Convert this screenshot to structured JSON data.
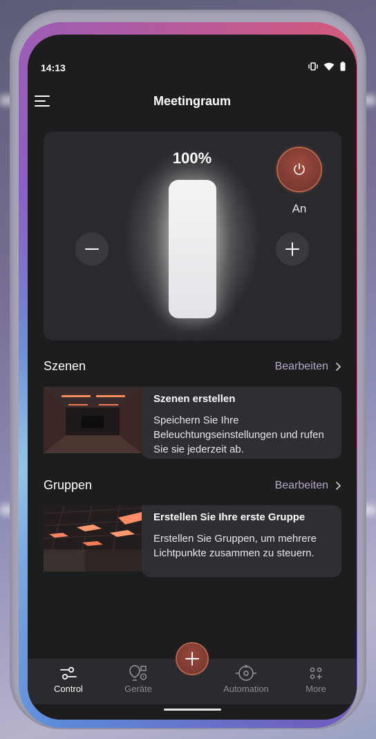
{
  "status": {
    "time": "14:13"
  },
  "header": {
    "title": "Meetingraum"
  },
  "control": {
    "brightness_text": "100%",
    "brightness_level": 1.0,
    "power_label": "An"
  },
  "scenes": {
    "title": "Szenen",
    "edit_label": "Bearbeiten",
    "card_title": "Szenen erstellen",
    "card_desc": "Speichern Sie Ihre Beleuchtungseinstellungen und rufen Sie sie jederzeit ab."
  },
  "groups": {
    "title": "Gruppen",
    "edit_label": "Bearbeiten",
    "card_title": "Erstellen Sie Ihre erste Gruppe",
    "card_desc": "Erstellen Sie Gruppen, um mehrere Lichtpunkte zusammen zu steuern."
  },
  "nav": {
    "items": [
      {
        "label": "Control",
        "icon": "control-icon",
        "active": true
      },
      {
        "label": "Geräte",
        "icon": "devices-icon",
        "active": false
      },
      {
        "label": "Automation",
        "icon": "automation-icon",
        "active": false
      },
      {
        "label": "More",
        "icon": "more-icon",
        "active": false
      }
    ]
  },
  "colors": {
    "accent": "#b8654e",
    "background": "#1d1d20",
    "card": "#2a2a2e",
    "edit_link": "#b5a9c4"
  }
}
